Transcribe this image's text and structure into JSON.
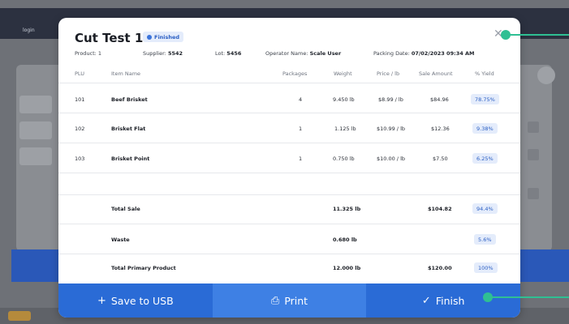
{
  "background": {
    "topbar_label": "login"
  },
  "modal": {
    "title": "Cut Test 1",
    "status_badge": "Finished",
    "close_icon": "close-icon",
    "meta": {
      "product_label": "Product: 1",
      "supplier_label": "Supplier: ",
      "supplier_value": "5542",
      "lot_label": "Lot: ",
      "lot_value": "5456",
      "operator_label": "Operator Name: ",
      "operator_value": "Scale User",
      "packing_date_label": "Packing Date: ",
      "packing_date_value": "07/02/2023 09:34 AM"
    },
    "columns": [
      "PLU",
      "Item Name",
      "Packages",
      "Weight",
      "Price / lb",
      "Sale Amount",
      "% Yield"
    ],
    "rows": [
      {
        "plu": "101",
        "name": "Beef Brisket",
        "packages": "4",
        "weight": "9.450 lb",
        "price": "$8.99 / lb",
        "amount": "$84.96",
        "yield": "78.75%"
      },
      {
        "plu": "102",
        "name": "Brisket Flat",
        "packages": "1",
        "weight": "1.125 lb",
        "price": "$10.99 / lb",
        "amount": "$12.36",
        "yield": "9.38%"
      },
      {
        "plu": "103",
        "name": "Brisket Point",
        "packages": "1",
        "weight": "0.750 lb",
        "price": "$10.00 / lb",
        "amount": "$7.50",
        "yield": "6.25%"
      }
    ],
    "totals": [
      {
        "label": "Total Sale",
        "weight": "11.325 lb",
        "amount": "$104.82",
        "yield": "94.4%"
      },
      {
        "label": "Waste",
        "weight": "0.680 lb",
        "amount": "",
        "yield": "5.6%"
      },
      {
        "label": "Total Primary Product",
        "weight": "12.000 lb",
        "amount": "$120.00",
        "yield": "100%"
      }
    ],
    "footer": {
      "save_label": "Save to USB",
      "save_icon": "+",
      "print_label": "Print",
      "print_icon": "⎙",
      "finish_label": "Finish",
      "finish_icon": "✓"
    }
  },
  "colors": {
    "primary": "#2a6bd6",
    "accent_callout": "#2fbf93",
    "badge_bg": "#e4ecfb"
  }
}
